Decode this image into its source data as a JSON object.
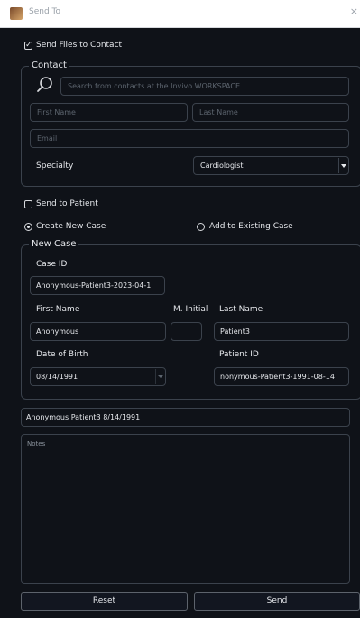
{
  "window": {
    "title": "Send To",
    "close_glyph": "×",
    "app_icon": "app-icon"
  },
  "send_files": {
    "label": "Send Files to Contact",
    "checked": true
  },
  "contact": {
    "group_title": "Contact",
    "search_placeholder": "Search from contacts at the Invivo WORKSPACE",
    "first_name_placeholder": "First Name",
    "last_name_placeholder": "Last Name",
    "email_placeholder": "Email",
    "specialty_label": "Specialty",
    "specialty_value": "Cardiologist"
  },
  "send_patient": {
    "label": "Send to Patient",
    "checked": false
  },
  "case_mode": {
    "create_label": "Create New Case",
    "existing_label": "Add to Existing Case",
    "selected": "create"
  },
  "new_case": {
    "group_title": "New Case",
    "case_id_label": "Case ID",
    "case_id_value": "Anonymous-Patient3-2023-04-1",
    "first_name_label": "First Name",
    "first_name_value": "Anonymous",
    "m_initial_label": "M. Initial",
    "m_initial_value": "",
    "last_name_label": "Last Name",
    "last_name_value": "Patient3",
    "dob_label": "Date of Birth",
    "dob_value": "08/14/1991",
    "patient_id_label": "Patient ID",
    "patient_id_value": "nonymous-Patient3-1991-08-14"
  },
  "summary": {
    "text": "Anonymous Patient3 8/14/1991"
  },
  "notes": {
    "placeholder": "Notes"
  },
  "buttons": {
    "reset": "Reset",
    "send": "Send"
  }
}
